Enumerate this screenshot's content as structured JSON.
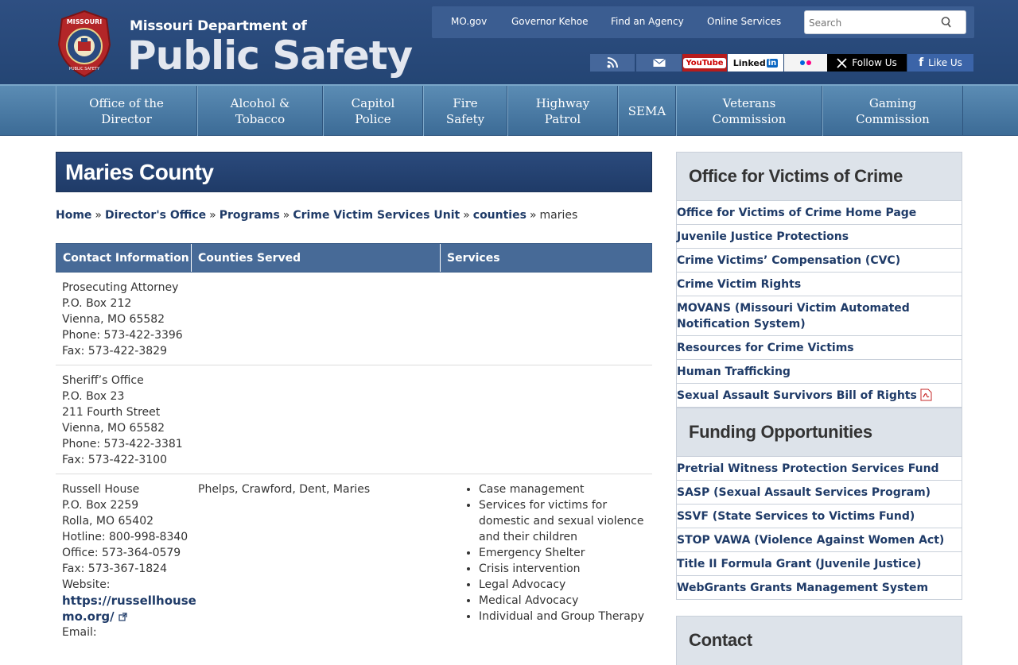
{
  "brand": {
    "top": "Missouri Department of",
    "main": "Public Safety",
    "seal_text_top": "MISSOURI",
    "seal_text_bottom": "PUBLIC SAFETY"
  },
  "topbar": {
    "links": [
      "MO.gov",
      "Governor Kehoe",
      "Find an Agency",
      "Online Services"
    ],
    "search_placeholder": "Search"
  },
  "social": {
    "youtube": "YouTube",
    "linkedin": "Linked",
    "linkedin_in": "in",
    "follow": "Follow Us",
    "like": "Like Us"
  },
  "nav": [
    {
      "line1": "Office of the",
      "line2": "Director"
    },
    {
      "line1": "Alcohol &",
      "line2": "Tobacco"
    },
    {
      "line1": "Capitol",
      "line2": "Police"
    },
    {
      "line1": "Fire",
      "line2": "Safety"
    },
    {
      "line1": "Highway",
      "line2": "Patrol"
    },
    {
      "line1": "SEMA",
      "line2": ""
    },
    {
      "line1": "Veterans",
      "line2": "Commission"
    },
    {
      "line1": "Gaming",
      "line2": "Commission"
    }
  ],
  "page": {
    "title": "Maries County"
  },
  "breadcrumb": {
    "items": [
      "Home",
      "Director's Office",
      "Programs",
      "Crime Victim Services Unit",
      "counties"
    ],
    "current": "maries",
    "separator": "»"
  },
  "table": {
    "headers": [
      "Contact Information",
      "Counties Served",
      "Services"
    ],
    "rows": [
      {
        "contact": [
          "Prosecuting Attorney",
          "P.O. Box 212",
          "Vienna, MO 65582",
          "Phone: 573-422-3396",
          "Fax: 573-422-3829"
        ],
        "counties": "",
        "services": []
      },
      {
        "contact": [
          "Sheriff’s Office",
          "P.O. Box 23",
          "211 Fourth Street",
          "Vienna, MO 65582",
          "Phone: 573-422-3381",
          "Fax: 573-422-3100"
        ],
        "counties": "",
        "services": []
      },
      {
        "contact": [
          "Russell House",
          "P.O. Box 2259",
          "Rolla, MO 65402",
          "Hotline: 800-998-8340",
          "Office: 573-364-0579",
          "Fax: 573-367-1824",
          "Website:"
        ],
        "website_line1": "https://russellhouse",
        "website_line2": "mo.org/",
        "email_label": "Email:",
        "counties": "Phelps, Crawford, Dent, Maries",
        "services": [
          "Case management",
          "Services for victims for domestic and sexual violence and their children",
          "Emergency Shelter",
          "Crisis intervention",
          "Legal Advocacy",
          "Medical Advocacy",
          "Individual and Group Therapy"
        ]
      }
    ]
  },
  "sidebar": {
    "heading1": "Office for Victims of Crime",
    "links1": [
      "Office for Victims of Crime Home Page",
      "Juvenile Justice Protections",
      "Crime Victims’ Compensation (CVC)",
      "Crime Victim Rights",
      "MOVANS (Missouri Victim Automated Notification System)",
      "Resources for Crime Victims",
      "Human Trafficking",
      "Sexual Assault Survivors Bill of Rights"
    ],
    "heading2": "Funding Opportunities",
    "links2": [
      "Pretrial Witness Protection Services Fund",
      "SASP (Sexual Assault Services Program)",
      "SSVF (State Services to Victims Fund)",
      "STOP VAWA (Violence Against Women Act)",
      "Title II Formula Grant (Juvenile Justice)",
      "WebGrants Grants Management System"
    ],
    "heading3": "Contact"
  },
  "colors": {
    "header": "#2e4f82",
    "nav": "#4a7aa4",
    "title_bar": "#243f6e",
    "table_header": "#476a97",
    "link": "#1f3b68",
    "sidebar_head": "#dde3ea"
  }
}
